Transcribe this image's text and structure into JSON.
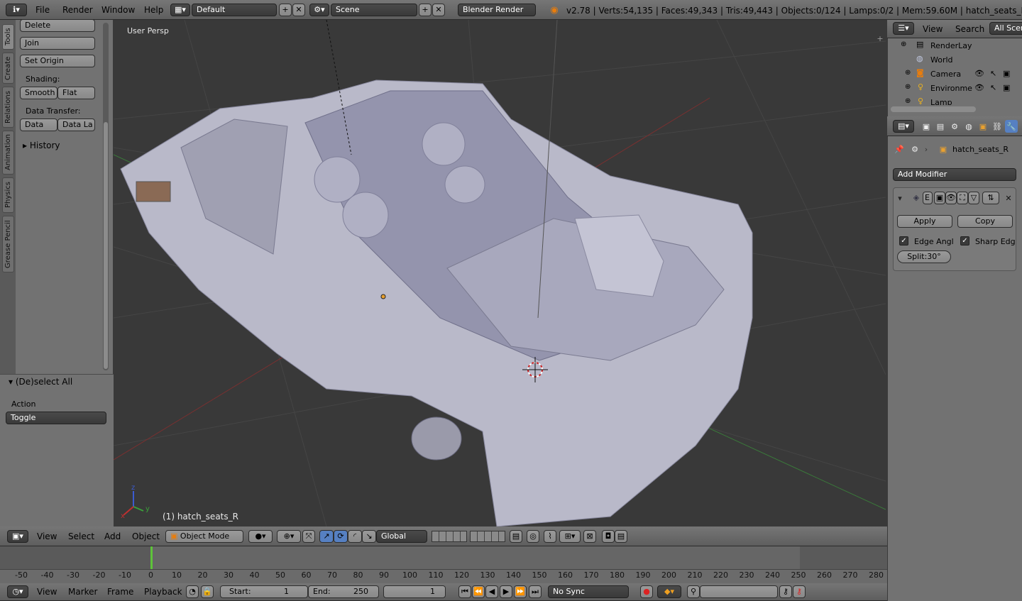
{
  "topbar": {
    "menus": [
      "File",
      "Render",
      "Window",
      "Help"
    ],
    "screen_layout": "Default",
    "scene": "Scene",
    "engine": "Blender Render",
    "stats": "v2.78 | Verts:54,135 | Faces:49,343 | Tris:49,443 | Objects:0/124 | Lamps:0/2 | Mem:59.60M | hatch_seats_R"
  },
  "toolshelf": {
    "tabs": [
      "Tools",
      "Create",
      "Relations",
      "Animation",
      "Physics",
      "Grease Pencil"
    ],
    "delete": "Delete",
    "join": "Join",
    "set_origin": "Set Origin",
    "shading_label": "Shading:",
    "smooth": "Smooth",
    "flat": "Flat",
    "data_transfer_label": "Data Transfer:",
    "data": "Data",
    "data_layout": "Data La",
    "history": "History"
  },
  "operator": {
    "title": "(De)select All",
    "action_label": "Action",
    "action_value": "Toggle"
  },
  "viewport": {
    "view_name": "User Persp",
    "active_object": "(1) hatch_seats_R",
    "axes": {
      "x": "x",
      "y": "y",
      "z": "z"
    }
  },
  "view3d_header": {
    "menus": [
      "View",
      "Select",
      "Add",
      "Object"
    ],
    "mode": "Object Mode",
    "orientation": "Global"
  },
  "timeline": {
    "ticks": [
      "-50",
      "-40",
      "-30",
      "-20",
      "-10",
      "0",
      "10",
      "20",
      "30",
      "40",
      "50",
      "60",
      "70",
      "80",
      "90",
      "100",
      "110",
      "120",
      "130",
      "140",
      "150",
      "160",
      "170",
      "180",
      "190",
      "200",
      "210",
      "220",
      "230",
      "240",
      "250",
      "260",
      "270",
      "280"
    ],
    "current_frame_marker": "1",
    "menus": [
      "View",
      "Marker",
      "Frame",
      "Playback"
    ],
    "start": "Start:",
    "start_value": "1",
    "end": "End:",
    "end_value": "250",
    "frame": "1",
    "sync": "No Sync"
  },
  "outliner": {
    "menus": [
      "View",
      "Search"
    ],
    "display": "All Scer",
    "items": [
      "RenderLay",
      "World",
      "Camera",
      "Environme",
      "Lamp"
    ]
  },
  "properties": {
    "object_name": "hatch_seats_R",
    "add_modifier": "Add Modifier",
    "apply": "Apply",
    "copy": "Copy",
    "edge_angle": "Edge Angl",
    "sharp_edges": "Sharp Edg",
    "split": "Split:30°"
  },
  "colors": {
    "header": "#6b6b6b",
    "panel": "#727272",
    "viewport": "#393939",
    "accent": "#5680c2",
    "current_frame": "#5ec33a"
  }
}
